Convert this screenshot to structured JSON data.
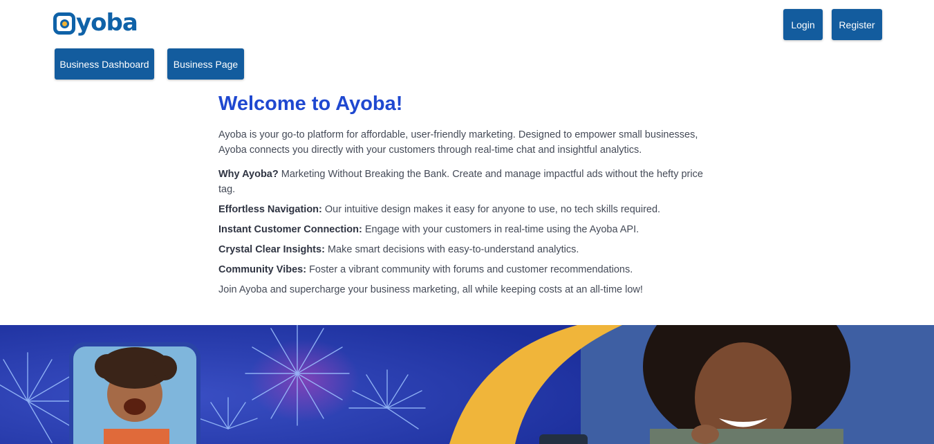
{
  "brand": {
    "name": "yoba",
    "logo_color": "#0f62a8",
    "accent": "#f2b234"
  },
  "header": {
    "login_label": "Login",
    "register_label": "Register"
  },
  "nav": {
    "dashboard_label": "Business Dashboard",
    "page_label": "Business Page"
  },
  "main": {
    "title": "Welcome to Ayoba!",
    "intro": "Ayoba is your go-to platform for affordable, user-friendly marketing. Designed to empower small businesses, Ayoba connects you directly with your customers through real-time chat and insightful analytics.",
    "features": [
      {
        "title": "Why Ayoba?",
        "text": "Marketing Without Breaking the Bank. Create and manage impactful ads without the hefty price tag."
      },
      {
        "title": "Effortless Navigation:",
        "text": "Our intuitive design makes it easy for anyone to use, no tech skills required."
      },
      {
        "title": "Instant Customer Connection:",
        "text": "Engage with your customers in real-time using the Ayoba API."
      },
      {
        "title": "Crystal Clear Insights:",
        "text": "Make smart decisions with easy-to-understand analytics."
      },
      {
        "title": "Community Vibes:",
        "text": "Foster a vibrant community with forums and customer recommendations."
      }
    ],
    "closing": "Join Ayoba and supercharge your business marketing, all while keeping costs at an all-time low!"
  },
  "colors": {
    "button_bg": "#135c9e",
    "title_color": "#1f48d0",
    "banner_left": "#2337a8",
    "banner_right": "#3e5fa3",
    "banner_arc": "#f0b53a"
  }
}
